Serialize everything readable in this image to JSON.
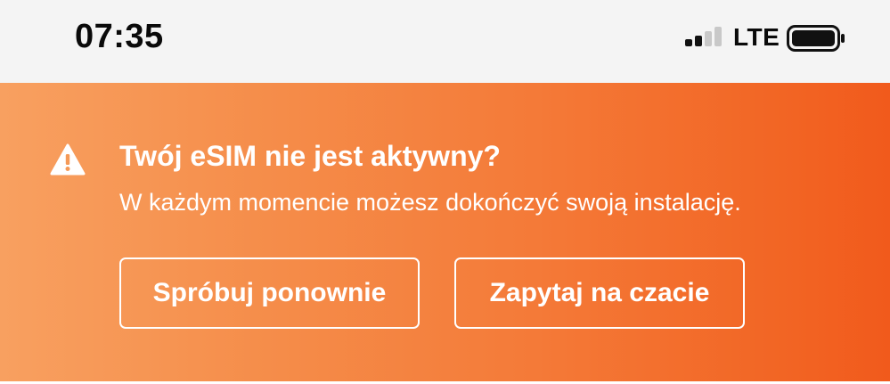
{
  "status_bar": {
    "time": "07:35",
    "network": "LTE"
  },
  "banner": {
    "title": "Twój eSIM nie jest aktywny?",
    "subtitle": "W każdym momencie możesz dokończyć swoją instalację.",
    "retry_button": "Spróbuj ponownie",
    "chat_button": "Zapytaj na czacie",
    "icon": "warning-icon",
    "colors": {
      "gradient_start": "#f8a060",
      "gradient_end": "#f15a1c",
      "text": "#ffffff"
    }
  },
  "icons": [
    "signal-strength-icon",
    "battery-icon",
    "warning-icon"
  ]
}
